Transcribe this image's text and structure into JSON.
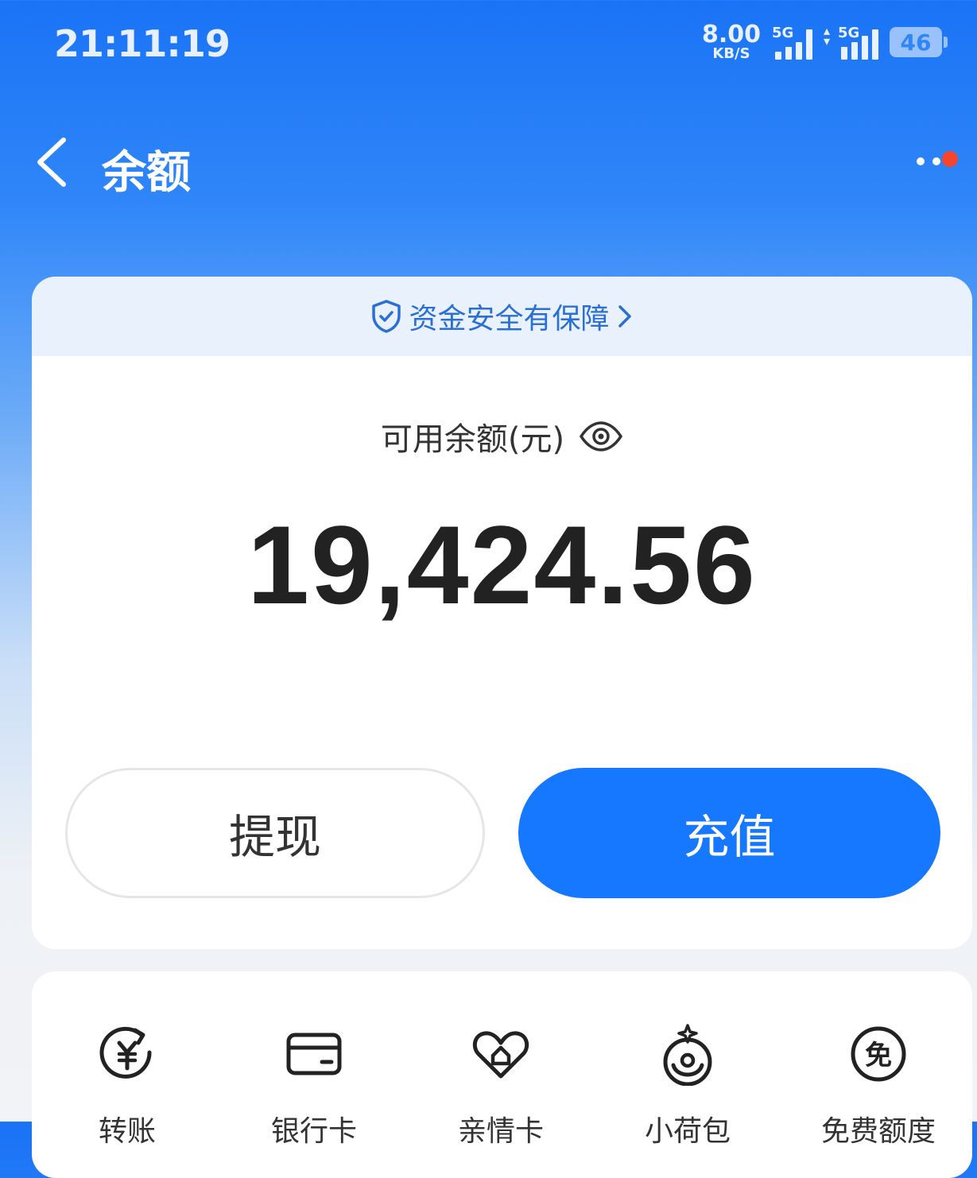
{
  "status_bar": {
    "time": "21:11:19",
    "net_speed_value": "8.00",
    "net_speed_unit": "KB/S",
    "sim1_tag": "5G",
    "sim2_tag": "5G",
    "battery": "46"
  },
  "nav": {
    "title": "余额",
    "back_icon": "chevron-left-icon",
    "more_icon": "more-dots-icon",
    "notification_dot_color": "#f5462d"
  },
  "balance_card": {
    "safety_text": "资金安全有保障",
    "safety_icon": "shield-check-icon",
    "label": "可用余额(元)",
    "eye_icon": "eye-icon",
    "amount": "19,424.56",
    "withdraw_label": "提现",
    "recharge_label": "充值",
    "accent_color": "#1677ff"
  },
  "services": [
    {
      "label": "转账",
      "icon": "transfer-yuan-icon"
    },
    {
      "label": "银行卡",
      "icon": "bank-card-icon"
    },
    {
      "label": "亲情卡",
      "icon": "family-card-heart-icon"
    },
    {
      "label": "小荷包",
      "icon": "purse-icon"
    },
    {
      "label": "免费额度",
      "icon": "free-quota-icon"
    }
  ]
}
